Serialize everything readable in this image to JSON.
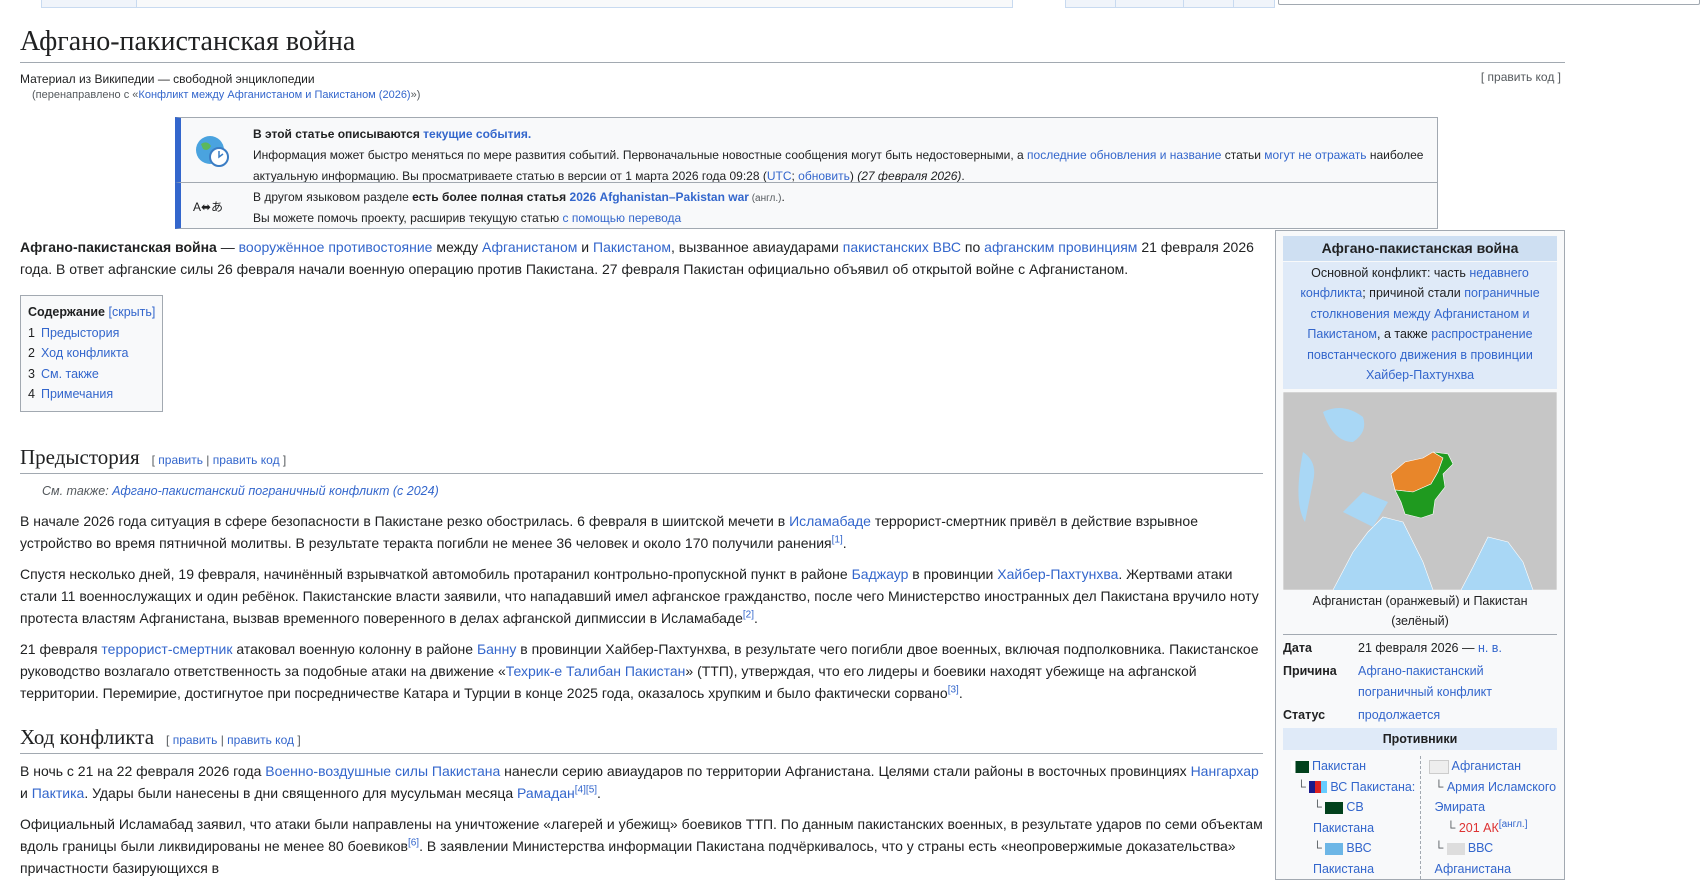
{
  "page": {
    "title": "Афгано-пакистанская война",
    "tagline": "Материал из Википедии — свободной энциклопедии",
    "redirect_prefix": "(перенаправлено с «",
    "redirect_link": "Конфликт между Афганистаном и Пакистаном (2026)",
    "redirect_suffix": "»)",
    "edit_code": "[ править код ]"
  },
  "notice_current": {
    "line1_bold": "В этой статье описываются ",
    "line1_link": "текущие события.",
    "body": [
      {
        "t": "Информация может быстро меняться по мере развития событий. Первоначальные новостные сообщения могут быть недостоверными, а "
      },
      {
        "t": "последние обновления и название",
        "l": 1
      },
      {
        "t": " статьи "
      },
      {
        "t": "могут не отражать",
        "l": 1
      },
      {
        "t": " наиболее актуальную информацию. Вы просматриваете статью в версии от 1 марта 2026 года 09:28 ("
      },
      {
        "t": "UTC",
        "l": 1
      },
      {
        "t": "; "
      },
      {
        "t": "обновить",
        "l": 1
      },
      {
        "t": ") "
      },
      {
        "t": "(27 февраля 2026)",
        "i": 1
      },
      {
        "t": "."
      }
    ]
  },
  "notice_lang": {
    "body": [
      {
        "t": "В другом языковом разделе "
      },
      {
        "t": "есть более полная статья ",
        "b": 1
      },
      {
        "t": "2026 Afghanistan–Pakistan war",
        "l": 1,
        "b": 1
      },
      {
        "t": "  (англ.)",
        "s": 1
      },
      {
        "t": "."
      }
    ],
    "help": [
      {
        "t": "Вы можете помочь проекту, расширив текущую статью "
      },
      {
        "t": "с помощью перевода",
        "l": 1
      }
    ],
    "icon_text": "A⬌あ"
  },
  "lead": [
    {
      "t": "Афгано-пакистанская война",
      "b": 1
    },
    {
      "t": " — "
    },
    {
      "t": "вооружённое противостояние",
      "l": 1
    },
    {
      "t": " между "
    },
    {
      "t": "Афганистаном",
      "l": 1
    },
    {
      "t": " и "
    },
    {
      "t": "Пакистаном",
      "l": 1
    },
    {
      "t": ", вызванное авиаударами "
    },
    {
      "t": "пакистанских ВВС",
      "l": 1
    },
    {
      "t": " по "
    },
    {
      "t": "афганским провинциям",
      "l": 1
    },
    {
      "t": " 21 февраля 2026 года. В ответ афганские силы 26 февраля начали военную операцию против Пакистана. 27 февраля Пакистан официально объявил об открытой войне с Афганистаном."
    }
  ],
  "toc": {
    "title": "Содержание",
    "toggle": "[скрыть]",
    "items": [
      {
        "num": "1",
        "label": "Предыстория"
      },
      {
        "num": "2",
        "label": "Ход конфликта"
      },
      {
        "num": "3",
        "label": "См. также"
      },
      {
        "num": "4",
        "label": "Примечания"
      }
    ]
  },
  "sections": [
    {
      "title": "Предыстория",
      "edit_open": "[ ",
      "edit": "править",
      "sep": " | ",
      "edit_code": "править код",
      "edit_close": " ]",
      "hatnote_prefix": "См. также: ",
      "hatnote_link": "Афгано-пакистанский пограничный конфликт (с 2024)",
      "paragraphs": [
        [
          {
            "t": "В начале 2026 года ситуация в сфере безопасности в Пакистане резко обострилась. 6 февраля в шиитской мечети в "
          },
          {
            "t": "Исламабаде",
            "l": 1
          },
          {
            "t": " террорист-смертник привёл в действие взрывное устройство во время пятничной молитвы. В результате теракта погибли не менее 36 человек и около 170 получили ранения"
          },
          {
            "t": "[1]",
            "sup": 1
          },
          {
            "t": "."
          }
        ],
        [
          {
            "t": "Спустя несколько дней, 19 февраля, начинённый взрывчаткой автомобиль протаранил контрольно-пропускной пункт в районе "
          },
          {
            "t": "Баджаур",
            "l": 1
          },
          {
            "t": " в провинции "
          },
          {
            "t": "Хайбер-Пахтунхва",
            "l": 1
          },
          {
            "t": ". Жертвами атаки стали 11 военнослужащих и один ребёнок. Пакистанские власти заявили, что нападавший имел афганское гражданство, после чего Министерство иностранных дел Пакистана вручило ноту протеста властям Афганистана, вызвав временного поверенного в делах афганской дипмиссии в Исламабаде"
          },
          {
            "t": "[2]",
            "sup": 1
          },
          {
            "t": "."
          }
        ],
        [
          {
            "t": "21 февраля "
          },
          {
            "t": "террорист-смертник",
            "l": 1
          },
          {
            "t": " атаковал военную колонну в районе "
          },
          {
            "t": "Банну",
            "l": 1
          },
          {
            "t": " в провинции Хайбер-Пахтунхва, в результате чего погибли двое военных, включая подполковника. Пакистанское руководство возлагало ответственность за подобные атаки на движение «"
          },
          {
            "t": "Техрик-е Талибан Пакистан",
            "l": 1
          },
          {
            "t": "» (ТТП), утверждая, что его лидеры и боевики находят убежище на афганской территории. Перемирие, достигнутое при посредничестве Катара и Турции в конце 2025 года, оказалось хрупким и было фактически сорвано"
          },
          {
            "t": "[3]",
            "sup": 1
          },
          {
            "t": "."
          }
        ]
      ]
    },
    {
      "title": "Ход конфликта",
      "edit_open": "[ ",
      "edit": "править",
      "sep": " | ",
      "edit_code": "править код",
      "edit_close": " ]",
      "paragraphs": [
        [
          {
            "t": "В ночь с 21 на 22 февраля 2026 года "
          },
          {
            "t": "Военно-воздушные силы Пакистана",
            "l": 1
          },
          {
            "t": " нанесли серию авиаударов по территории Афганистана. Целями стали районы в восточных провинциях "
          },
          {
            "t": "Нангархар",
            "l": 1
          },
          {
            "t": " и "
          },
          {
            "t": "Пактика",
            "l": 1
          },
          {
            "t": ". Удары были нанесены в дни священного для мусульман месяца "
          },
          {
            "t": "Рамадан",
            "l": 1
          },
          {
            "t": "[4][5]",
            "sup": 1
          },
          {
            "t": "."
          }
        ],
        [
          {
            "t": "Официальный Исламабад заявил, что атаки были направлены на уничтожение «лагерей и убежищ» боевиков ТТП. По данным пакистанских военных, в результате ударов по семи объектам вдоль границы были ликвидированы не менее 80 боевиков"
          },
          {
            "t": "[6]",
            "sup": 1
          },
          {
            "t": ". В заявлении Министерства информации Пакистана подчёркивалось, что у страны есть «неопровержимые доказательства» причастности базирующихся в"
          }
        ]
      ]
    }
  ],
  "infobox": {
    "title": "Афгано-пакистанская война",
    "subtitle": [
      {
        "t": "Основной конфликт: часть "
      },
      {
        "t": "недавнего конфликта",
        "l": 1
      },
      {
        "t": "; причиной стали "
      },
      {
        "t": "пограничные столкновения между Афганистаном и Пакистаном",
        "l": 1
      },
      {
        "t": ", а также "
      },
      {
        "t": "распространение повстанческого движения в провинции Хайбер-Пахтунхва",
        "l": 1
      }
    ],
    "map_caption": "Афганистан (оранжевый) и Пакистан (зелёный)",
    "date_label": "Дата",
    "date_value": "21 февраля 2026 — ",
    "date_link": "н. в.",
    "cause_label": "Причина",
    "cause_value": "Афгано-пакистанский пограничный конфликт",
    "status_label": "Статус",
    "status_value": "продолжается",
    "belligerents_header": "Противники",
    "left": {
      "country": "Пакистан",
      "forces": "ВС Пакистана:",
      "army": "СВ Пакистана",
      "air": "ВВС Пакистана"
    },
    "right": {
      "country": "Афганистан",
      "army": "Армия Исламского Эмирата",
      "corps": "201 АК",
      "corps_sup": "[англ.]",
      "air": "ВВС Афганистана"
    },
    "colors": {
      "afghanistan": "#e8862a",
      "pakistan": "#1f9a1f",
      "land": "#c6c6c6",
      "water": "#a9d7f5"
    }
  }
}
